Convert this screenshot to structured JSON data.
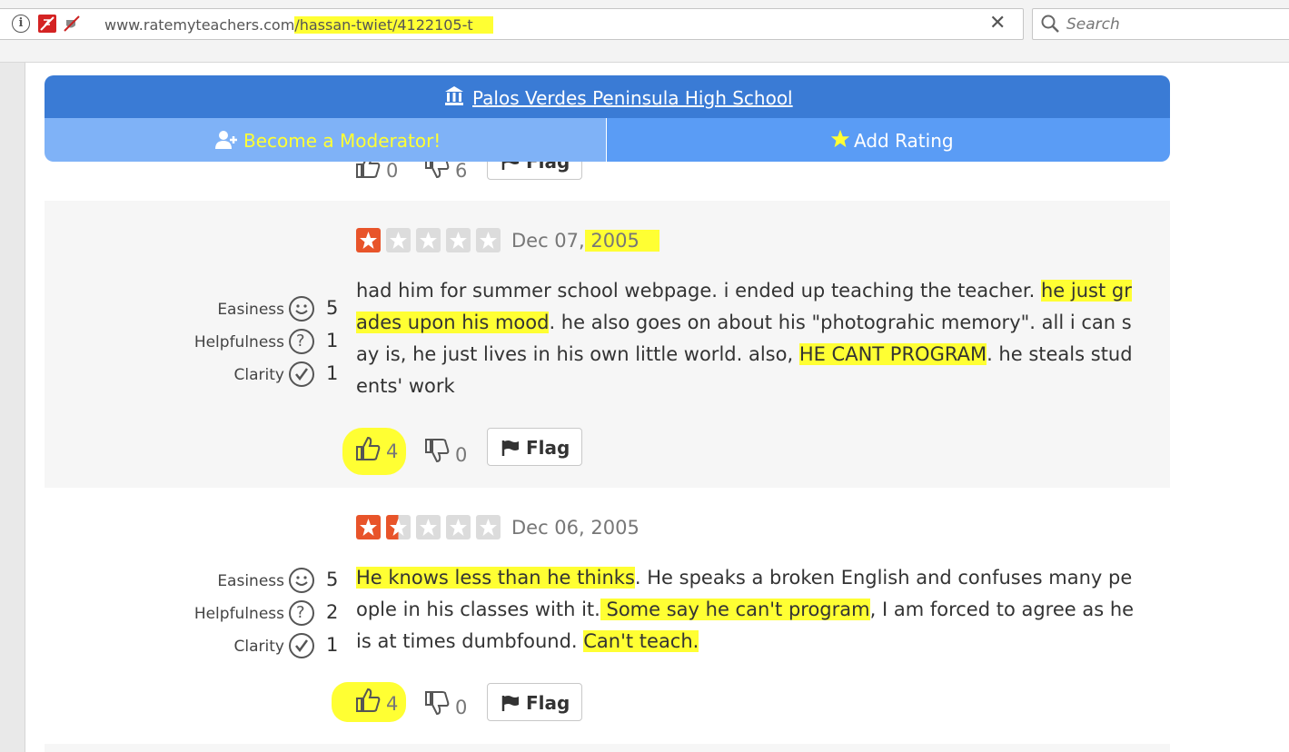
{
  "browser": {
    "url_host": "www.ratemyteachers.com",
    "url_path": "/hassan-twiet/4122105-t",
    "search_placeholder": "Search"
  },
  "header": {
    "school_name": "Palos Verdes Peninsula High School",
    "moderator_label": "Become a Moderator!",
    "add_rating_label": "Add Rating"
  },
  "prev_review": {
    "up_count": "0",
    "down_count": "6",
    "flag_label": "Flag"
  },
  "score_labels": {
    "easiness": "Easiness",
    "helpfulness": "Helpfulness",
    "clarity": "Clarity"
  },
  "reviews": [
    {
      "stars": 1,
      "date_prefix": "Dec 07,",
      "date_year": " 2005",
      "easiness": "5",
      "helpfulness": "1",
      "clarity": "1",
      "text_1": "had him for summer school webpage. i ended up teaching the teacher. ",
      "text_2": "he just grades upon his mood",
      "text_3": ". he also goes on about his \"photograhic memory\". all i can say is, he just lives in his own little world. also, ",
      "text_4": "HE CANT PROGRAM",
      "text_5": ". he steals students' work",
      "up_count": "4",
      "down_count": "0",
      "flag_label": "Flag"
    },
    {
      "stars": 1.5,
      "date": "Dec 06, 2005",
      "easiness": "5",
      "helpfulness": "2",
      "clarity": "1",
      "text_1": "He knows less than he thinks",
      "text_2": ". He speaks a broken English and confuses many people in his classes with it.",
      "text_3": " Some say he can't program",
      "text_4": ", I am forced to agree as he is at times dumbfound. ",
      "text_5": "Can't teach. ",
      "up_count": "4",
      "down_count": "0",
      "flag_label": "Flag"
    }
  ],
  "colors": {
    "highlight": "#ffff33",
    "star_on": "#e8542a",
    "header_blue": "#3a7bd5",
    "moderator_bg": "#7fb2f7"
  }
}
